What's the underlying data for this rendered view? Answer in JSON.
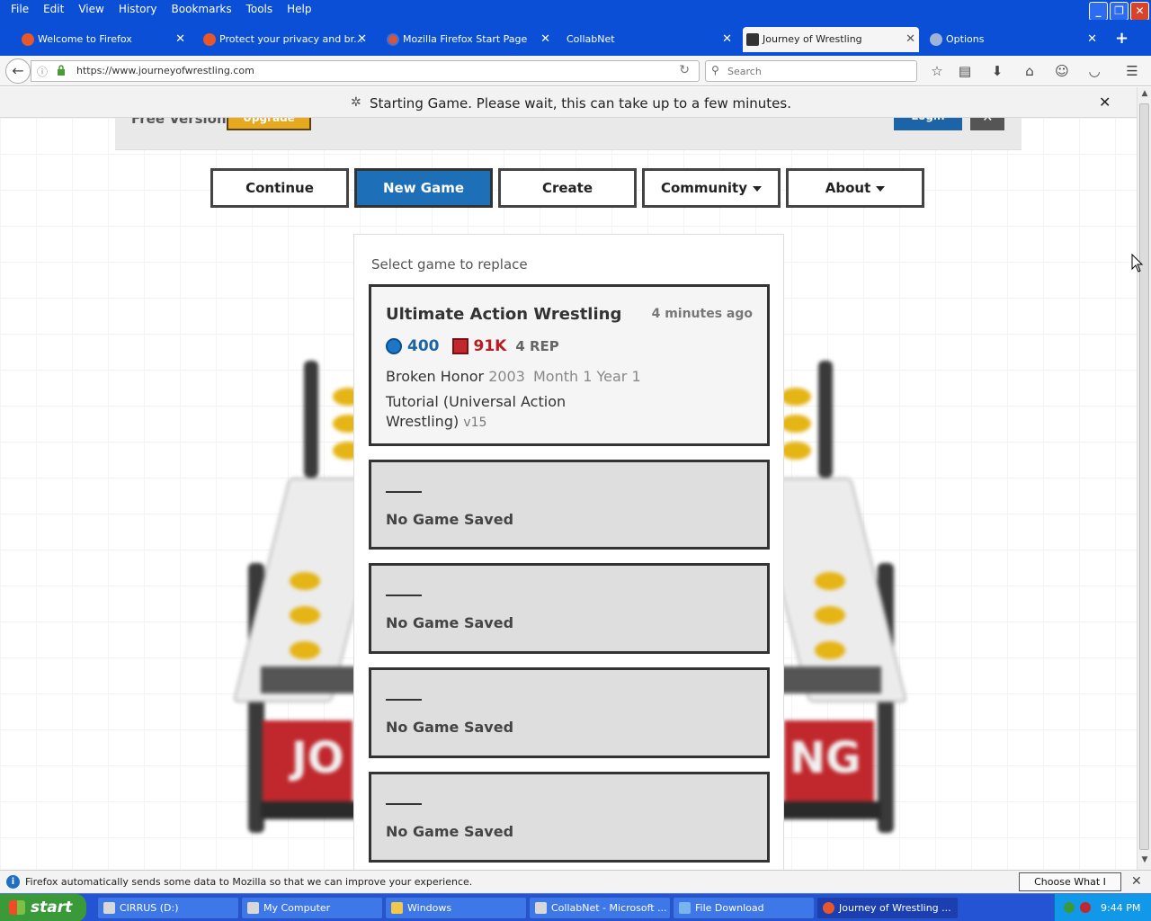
{
  "menubar": {
    "items": [
      "File",
      "Edit",
      "View",
      "History",
      "Bookmarks",
      "Tools",
      "Help"
    ]
  },
  "tabs": [
    {
      "label": "Welcome to Firefox",
      "icon": "firefox-icon"
    },
    {
      "label": "Protect your privacy and br...",
      "icon": "firefox-icon"
    },
    {
      "label": "Mozilla Firefox Start Page",
      "icon": "firefox-icon"
    },
    {
      "label": "CollabNet",
      "icon": ""
    },
    {
      "label": "Journey of Wrestling",
      "icon": "jow-icon",
      "active": true
    },
    {
      "label": "Options",
      "icon": "gear-icon"
    }
  ],
  "navbar": {
    "url": "https://www.journeyofwrestling.com",
    "search_placeholder": "Search"
  },
  "notification": {
    "message": "Starting Game. Please wait, this can take up to a few minutes."
  },
  "site": {
    "free_label": "Free Version",
    "upgrade_label": "Upgrade",
    "login_label": "Login",
    "nav": [
      {
        "label": "Continue",
        "active": false,
        "dropdown": false
      },
      {
        "label": "New Game",
        "active": true,
        "dropdown": false
      },
      {
        "label": "Create",
        "active": false,
        "dropdown": false
      },
      {
        "label": "Community",
        "active": false,
        "dropdown": true
      },
      {
        "label": "About",
        "active": false,
        "dropdown": true
      }
    ],
    "ring_left_text": "JO",
    "ring_right_text": "NG"
  },
  "panel": {
    "title": "Select game to replace",
    "saved": {
      "name": "Ultimate Action Wrestling",
      "when": "4 minutes ago",
      "money": "400",
      "fans": "91K",
      "rep": "4 REP",
      "promotion": "Broken Honor",
      "year": "2003",
      "date": "Month 1 Year 1",
      "scenario": "Tutorial (Universal Action Wrestling)",
      "version": "v15"
    },
    "empty_label": "No Game Saved"
  },
  "databar": {
    "message": "Firefox automatically sends some data to Mozilla so that we can improve your experience.",
    "button": "Choose What I Share"
  },
  "taskbar": {
    "start": "start",
    "tasks": [
      "CIRRUS (D:)",
      "My Computer",
      "Windows",
      "CollabNet - Microsoft ...",
      "File Download",
      "Journey of Wrestling ..."
    ],
    "clock": "9:44 PM"
  },
  "colors": {
    "accent": "#1d6fb8",
    "upgrade": "#e7a920",
    "ring_apron": "#c0282d",
    "xp_blue": "#0a4fd6"
  }
}
